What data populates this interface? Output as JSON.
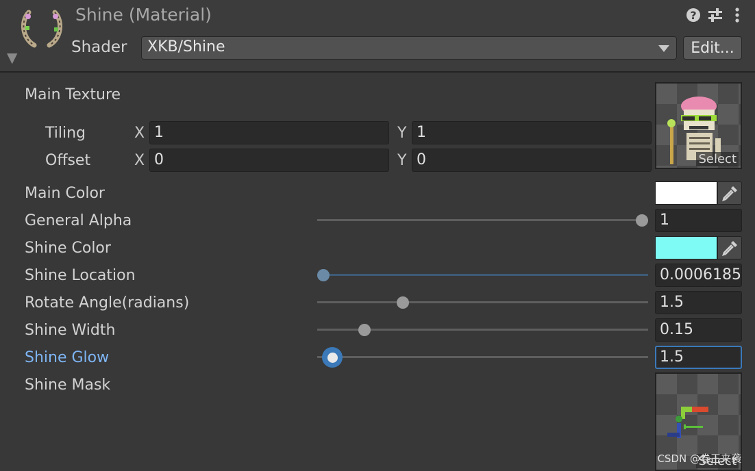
{
  "header": {
    "title": "Shine (Material)",
    "shader_label": "Shader",
    "shader_value": "XKB/Shine",
    "edit_label": "Edit..."
  },
  "properties": {
    "main_texture": {
      "label": "Main Texture",
      "tiling": {
        "label": "Tiling",
        "x_axis": "X",
        "x": "1",
        "y_axis": "Y",
        "y": "1"
      },
      "offset": {
        "label": "Offset",
        "x_axis": "X",
        "x": "0",
        "y_axis": "Y",
        "y": "0"
      },
      "select_label": "Select"
    },
    "main_color": {
      "label": "Main Color",
      "color": "#ffffff"
    },
    "general_alpha": {
      "label": "General Alpha",
      "value": "1",
      "slider_fraction": 1.0
    },
    "shine_color": {
      "label": "Shine Color",
      "color": "#7ffbf6"
    },
    "shine_location": {
      "label": "Shine Location",
      "value": "0.0006185",
      "slider_fraction": 0.0006
    },
    "rotate_angle": {
      "label": "Rotate Angle(radians)",
      "value": "1.5",
      "slider_fraction": 0.25
    },
    "shine_width": {
      "label": "Shine Width",
      "value": "0.15",
      "slider_fraction": 0.13
    },
    "shine_glow": {
      "label": "Shine Glow",
      "value": "1.5",
      "slider_fraction": 0.015
    },
    "shine_mask": {
      "label": "Shine Mask",
      "select_label": "Select"
    }
  },
  "colors": {
    "accent": "#3b79b8",
    "active_label": "#7eb5f5",
    "background": "#383838"
  },
  "icons": [
    "help-icon",
    "settings-sliders-icon",
    "more-options-icon",
    "eyedropper-icon",
    "dropdown-caret-icon",
    "foldout-arrow-icon"
  ],
  "watermark": "CSDN @卷王来袭"
}
